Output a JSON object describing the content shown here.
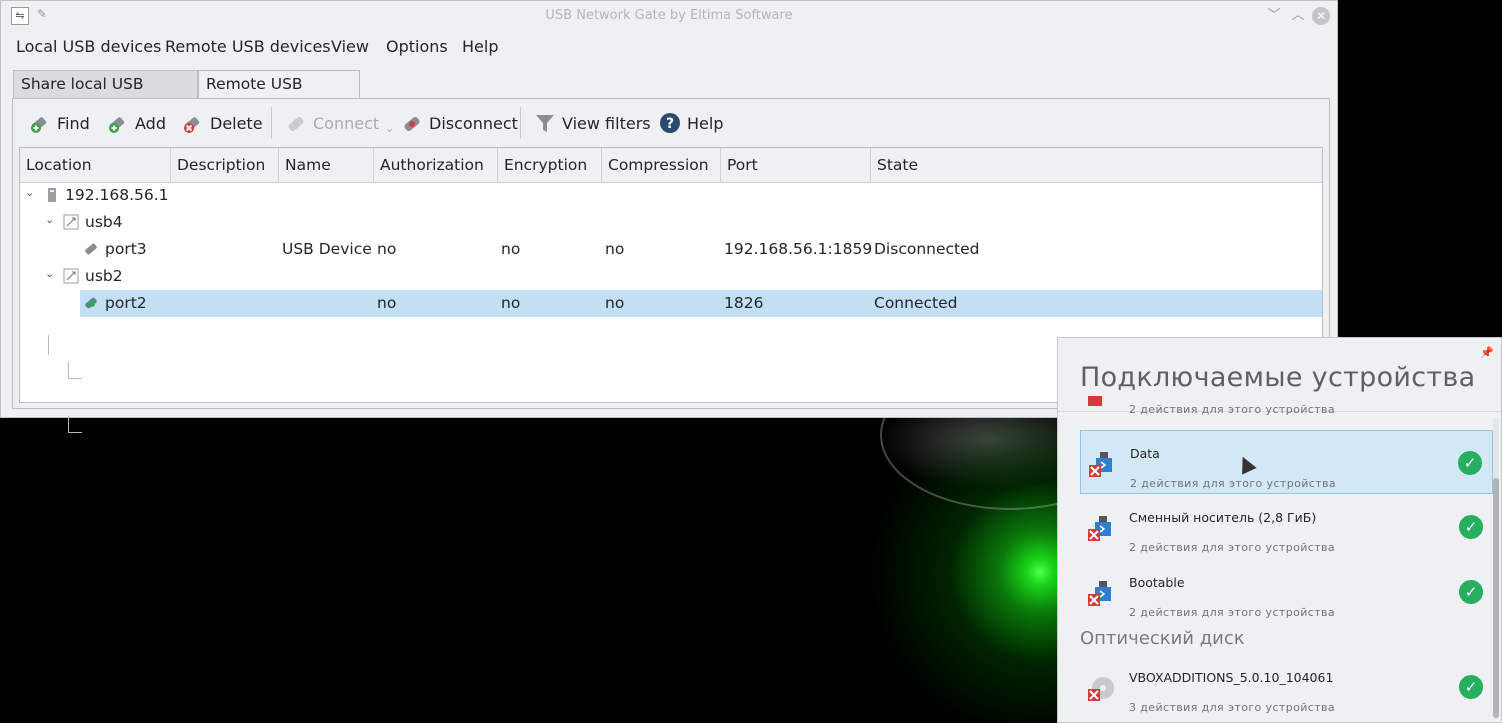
{
  "window": {
    "title": "USB Network Gate by Eltima Software"
  },
  "menu": [
    "Local USB devices",
    "Remote USB devices",
    "View",
    "Options",
    "Help"
  ],
  "tabs": [
    {
      "label": "Share local USB devices",
      "active": false
    },
    {
      "label": "Remote USB devices",
      "active": true
    }
  ],
  "toolbar": {
    "find": "Find",
    "add": "Add",
    "delete": "Delete",
    "connect": "Connect",
    "disconnect": "Disconnect",
    "view_filters": "View filters",
    "help": "Help"
  },
  "columns": [
    "Location",
    "Description",
    "Name",
    "Authorization",
    "Encryption",
    "Compression",
    "Port",
    "State"
  ],
  "tree": {
    "host": "192.168.56.1",
    "hubs": [
      {
        "label": "usb4",
        "ports": [
          {
            "location": "port3",
            "description": "",
            "name": "USB Device",
            "authorization": "no",
            "encryption": "no",
            "compression": "no",
            "port": "192.168.56.1:1859",
            "state": "Disconnected"
          }
        ]
      },
      {
        "label": "usb2",
        "ports": [
          {
            "location": "port2",
            "description": "",
            "name": "",
            "authorization": "no",
            "encryption": "no",
            "compression": "no",
            "port": "1826",
            "state": "Connected"
          }
        ]
      }
    ]
  },
  "notifier": {
    "title": "Подключаемые устройства",
    "partial_sub": "2 действия для этого устройства",
    "devices": [
      {
        "name": "Data",
        "sub": "2 действия для этого устройства"
      },
      {
        "name": "Сменный носитель (2,8 ГиБ)",
        "sub": "2 действия для этого устройства"
      },
      {
        "name": "Bootable",
        "sub": "2 действия для этого устройства"
      }
    ],
    "section": "Оптический диск",
    "optical": {
      "name": "VBOXADDITIONS_5.0.10_104061",
      "sub": "3 действия для этого устройства"
    }
  },
  "colors": {
    "selection": "#c3dff3",
    "check": "#27ae60",
    "window_bg": "#eff0f1"
  }
}
